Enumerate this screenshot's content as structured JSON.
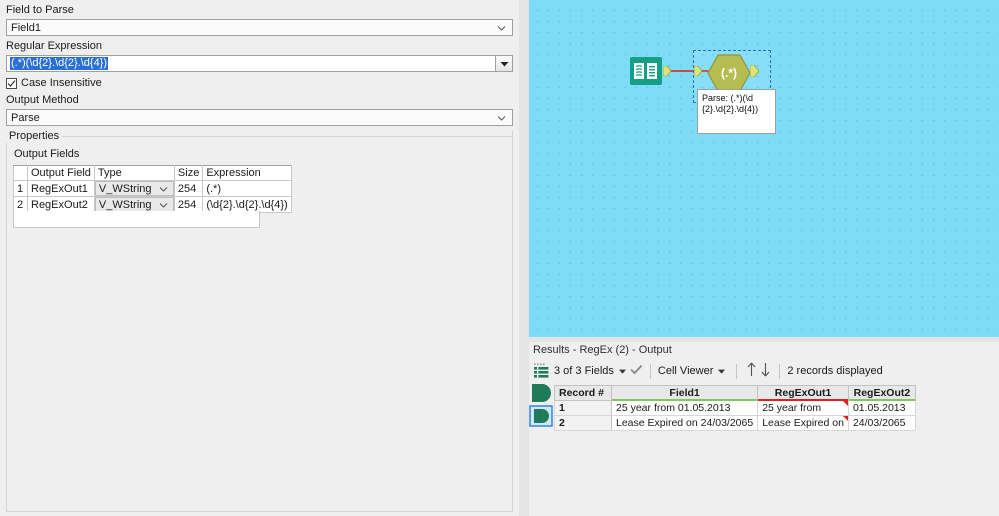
{
  "config": {
    "field_to_parse": {
      "label": "Field to Parse",
      "value": "Field1",
      "icon": "chevron-down-icon"
    },
    "regular_expression": {
      "label": "Regular Expression",
      "value": "(.*)(\\d{2}.\\d{2}.\\d{4})",
      "dropdown_icon": "triangle-down-icon"
    },
    "case_insensitive": {
      "label": "Case Insensitive",
      "checked": true,
      "icon": "checkmark-icon"
    },
    "output_method": {
      "label": "Output Method",
      "value": "Parse",
      "icon": "chevron-down-icon"
    },
    "properties_legend": "Properties",
    "output_fields_label": "Output Fields",
    "output_fields_table": {
      "columns": [
        "",
        "Output Field",
        "Type",
        "Size",
        "Expression"
      ],
      "rows": [
        {
          "index": "1",
          "name": "RegExOut1",
          "type": "V_WString",
          "size": "254",
          "expression": "(.*)"
        },
        {
          "index": "2",
          "name": "RegExOut2",
          "type": "V_WString",
          "size": "254",
          "expression": "(\\d{2}.\\d{2}.\\d{4})"
        }
      ]
    }
  },
  "canvas": {
    "background_color": "#7fdcf7",
    "input_node": {
      "name": "input-data-tool",
      "icon": "book-icon",
      "color": "#13a085"
    },
    "regex_node": {
      "name": "regex-tool",
      "label": "(.*)",
      "color": "#b5bd52",
      "selected": true
    },
    "connector_color": "#c24f4b",
    "annotation": "Parse: (.*)(\\d{2}.\\d{2}.\\d{4})"
  },
  "results": {
    "title": "Results - RegEx (2) - Output",
    "toolbar": {
      "grid_icon": "list-view-icon",
      "fields_selector": "3 of 3 Fields",
      "fields_caret": "caret-down-icon",
      "check_icon": "checkmark-icon",
      "viewer_selector": "Cell Viewer",
      "viewer_caret": "caret-down-icon",
      "sort_up_icon": "arrow-up-icon",
      "sort_down_icon": "arrow-down-icon",
      "record_count": "2 records displayed"
    },
    "sidebar": {
      "output_anchor_icon": "output-anchor-icon",
      "selected_anchor_icon": "selected-anchor-icon"
    },
    "grid": {
      "columns": [
        {
          "label": "Record #",
          "underline": "none"
        },
        {
          "label": "Field1",
          "underline": "#7ec95a"
        },
        {
          "label": "RegExOut1",
          "underline": "#e02020"
        },
        {
          "label": "RegExOut2",
          "underline": "#7ec95a"
        }
      ],
      "rows": [
        {
          "record": "1",
          "field1": "25 year from 01.05.2013",
          "regexout1": "25 year from",
          "regexout1_flag": true,
          "regexout2": "01.05.2013"
        },
        {
          "record": "2",
          "field1": "Lease Expired on 24/03/2065",
          "regexout1": "Lease Expired on",
          "regexout1_flag": true,
          "regexout2": "24/03/2065"
        }
      ]
    }
  }
}
